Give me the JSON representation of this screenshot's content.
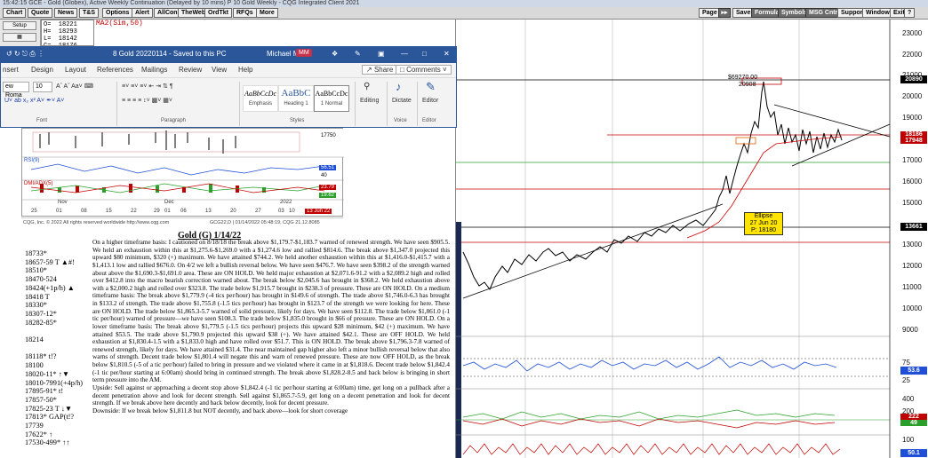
{
  "cqg": {
    "title": "15:42:15  GCE - Gold (Globex), Active Weekly Continuation (Delayed by 10 mins)  P 10 Gold Weekly - CQG Integrated Client 2021",
    "menu": [
      "Chart",
      "Quote",
      "News",
      "T&S",
      "Options",
      "Alert",
      "AllCon",
      "TheWeb",
      "OrdTkt",
      "RFQs",
      "More"
    ],
    "right_menu": [
      "Page",
      "Save",
      "Formula",
      "Symbols",
      "MSG Cntr",
      "Support",
      "Window",
      "Exit",
      "?"
    ],
    "setup_label": "Setup",
    "quote_lines": "O=  18221\nH=  18293\nL=  18142\nC=  18176",
    "ma_label": "MA2(Sim,50)"
  },
  "word": {
    "doc_title": "8 Gold 20220114  -  Saved to this PC",
    "user": "Michael Moor",
    "user_initials": "MM",
    "menu": [
      "nsert",
      "Design",
      "Layout",
      "References",
      "Mailings",
      "Review",
      "View",
      "Help"
    ],
    "share": "Share",
    "comments": "Comments",
    "font_name": "ew Roma",
    "font_size": "10",
    "styles": [
      {
        "sample": "AaBbCcDc",
        "name": "Emphasis"
      },
      {
        "sample": "AaBbC",
        "name": "Heading 1"
      },
      {
        "sample": "AaBbCcDc",
        "name": "1 Normal"
      }
    ],
    "groups": [
      "Font",
      "Paragraph",
      "Styles",
      "Voice",
      "Editor"
    ],
    "editing": "Editing",
    "dictate": "Dictate",
    "editor": "Editor"
  },
  "gold_chart": {
    "price_label": "17750",
    "rsi_label": "RSI(9)",
    "rsi_value": "56.51",
    "rsi_level": "40",
    "dmi_label": "DMI/ADX(5)",
    "dmi_values": [
      "23.79",
      "19.62"
    ],
    "month_labels": [
      "Nov",
      "Dec",
      "2022"
    ],
    "day_labels": [
      "25",
      "01",
      "08",
      "15",
      "22",
      "29",
      "01",
      "06",
      "13",
      "20",
      "27",
      "03",
      "10"
    ],
    "date_badge": "13 Jun 22",
    "footer_left": "CQG, Inc.  © 2022 All rights reserved worldwide  http://www.cqg.com",
    "footer_right": "GCG22,D | 01/14/2022 05:48:19, CQG 21.12.8085"
  },
  "doc": {
    "heading": "Gold (G) 1/14/22",
    "levels": [
      "18733*",
      "18657-59 T ▲#!",
      "18510*",
      "18470-524",
      "18424(+1p/h) ▲",
      "18418 T",
      "18330*",
      "18307-12*",
      "18282-85*",
      "",
      "18214",
      "",
      "18118*        t!?",
      "18100",
      "18020-11*  ↑▼",
      "18010-7991(+4p/h)",
      "17895-91*    t!",
      "17857-50*",
      "17825-23 T ↓▼",
      "17813*   GAP(t!?",
      "17739",
      "17622*          ↑",
      "17530-499*    ↑↑"
    ],
    "paragraphs": [
      "On a higher timeframe basis: I cautioned on 8/18/18 the break above $1,179.7-$1,183.7 warned of renewed strength. We have seen $905.5. We held an exhaustion within this at $1,275.6-$1,269.0 with a $1,274.6 low and rallied $814.6. The break above $1,347.0 projected this upward $80 minimum, $320 (+) maximum. We have attained $744.2. We held another exhaustion within this at $1,416.0-$1,415.7 with a $1,413.1 low and rallied $676.0. On 4/2 we left a bullish reversal below. We have seen $476.7. We have seen $398.2 of the strength warned about above the $1,690.3-$1,691.0 area. These are ON HOLD. We held major exhaustion at $2,071.6-91.2 with a $2,089.2 high and rolled over $412.8 into the macro bearish correction warned about. The break below $2,045.6 has brought in $368.2. We held exhaustion above with a $2,000.2 high and rolled over $323.8. The trade below $1,915.7 brought in $238.3 of pressure. These are ON HOLD. On a medium timeframe basis: The break above $1,779.9 (-4 tics per/hour) has brought in $149.6 of strength. The trade above $1,746.0-6.3 has brought in $133.2 of strength. The trade above $1,755.8 (-1.5 tics per/hour) has brought in $123.7 of the strength we were looking for here. These are ON HOLD. The trade below $1,865.3-5.7 warned of solid pressure, likely for days. We have seen $112.8. The trade below $1,861.0 (-1 tic per/hour) warned of pressure—we have seen $108.3. The trade below $1,835.0 brought in $66 of pressure. These are ON HOLD. On a lower timeframe basis: The break above $1,779.5 (-1.5 tics per/hour) projects this upward $28 minimum, $42 (+) maximum. We have attained $53.5. The trade above $1,790.9 projected this upward $38 (+). We have attained $42.1. These are OFF HOLD. We held exhaustion at $1,830.4-1.5 with a $1,833.0 high and have rolled over $51.7. This is ON HOLD. The break above $1,796.3-7.8 warned of renewed strength, likely for days. We have attained $31.4. The near maintained gap higher also left a minor bullish reversal below that also warns of strength. Decent trade below $1,801.4 will negate this and warn of renewed pressure. These are now OFF HOLD, as the break below $1,810.5 (-5 of a tic per/hour) failed to bring in pressure and we violated where it came in at $1,818.6. Decent trade below $1,842.4 (-1 tic per/hour starting at 6:00am) should bring in continued strength. The break above $1,828.2-8.5 and back below is bringing in short term pressure into the AM.",
      "Upside: Sell against or approaching a decent stop above $1,842.4 (-1 tic per/hour starting at 6:00am) time, get long on a pullback after a decent penetration above and look for decent strength. Sell against $1,865.7-5.9, get long on a decent penetration and look for decent strength. If we break above here decently and back below decently, look for decent pressure.",
      "Downside: If we break below $1,811.8 but NOT decently, and back above—look for short coverage"
    ]
  },
  "main_chart": {
    "y_ticks": [
      "23000",
      "22000",
      "21000",
      "20000",
      "19000",
      "18000",
      "17000",
      "16000",
      "15000",
      "14000",
      "13000",
      "12000",
      "11000",
      "10000",
      "9000"
    ],
    "last_price": "18186",
    "last_price_sub": "17948",
    "high_label": "20890",
    "high_annot": "$69270.00",
    "high_annot2": "20908",
    "low_label": "13661",
    "date_box": [
      "Ellipse",
      "27 Jun 20",
      "P:  18180"
    ],
    "rsi_ticks": [
      "75",
      "25"
    ],
    "rsi_value": "53.6",
    "osc_ticks": [
      "400",
      "200"
    ],
    "osc_values": [
      "222",
      "49"
    ],
    "vol_ticks": [
      "100",
      "50"
    ],
    "vol_value": "50.1",
    "colors": {
      "price_line": "#000000",
      "ma_line": "#d00000",
      "triangle": "#000000",
      "green_h": "#2aa02a",
      "red_h": "#c00000",
      "blue_osc": "#1f4fd6"
    }
  }
}
